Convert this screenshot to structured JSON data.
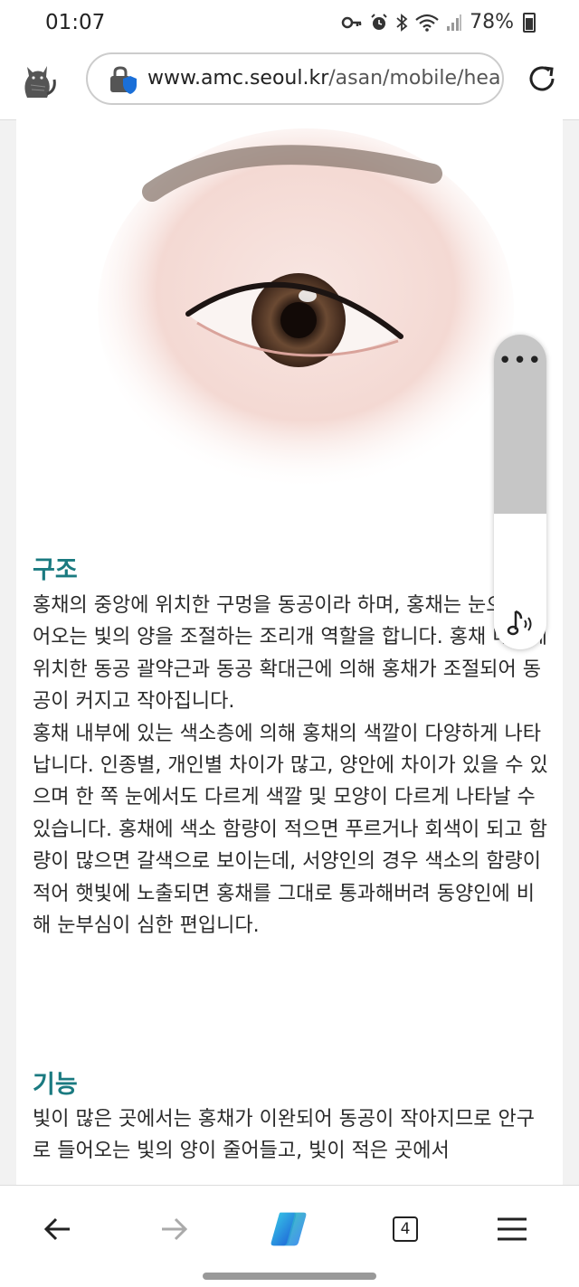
{
  "status_bar": {
    "time": "01:07",
    "battery": "78%"
  },
  "browser": {
    "url_host": "www.amc.seoul.kr",
    "url_path": "/asan/mobile/healt",
    "tab_count": "4"
  },
  "article": {
    "structure_title": "구조",
    "structure_p1": "홍채의 중앙에 위치한 구멍을 동공이라 하며, 홍채는 눈으로 들어오는 빛의 양을 조절하는 조리개 역할을 합니다. 홍채 내부에 위치한 동공 괄약근과 동공 확대근에 의해 홍채가 조절되어 동공이 커지고 작아집니다.",
    "structure_p2": "홍채 내부에 있는 색소층에 의해 홍채의 색깔이 다양하게 나타납니다. 인종별, 개인별 차이가 많고, 양안에 차이가 있을 수 있으며 한 쪽 눈에서도 다르게 색깔 및 모양이 다르게 나타날 수 있습니다. 홍채에 색소 함량이 적으면 푸르거나 회색이 되고 함량이 많으면 갈색으로 보이는데, 서양인의 경우 색소의 함량이 적어 햇빛에 노출되면 홍채를 그대로 통과해버려 동양인에 비해 눈부심이 심한 편입니다.",
    "function_title": "기능",
    "function_p1": "빛이 많은 곳에서는 홍채가 이완되어 동공이 작아지므로 안구로 들어오는 빛의 양이 줄어들고, 빛이 적은 곳에서"
  },
  "colors": {
    "heading": "#1a7a80"
  },
  "icons": [
    "key-icon",
    "alarm-icon",
    "bluetooth-icon",
    "wifi-icon",
    "signal-icon",
    "battery-icon",
    "lock-shield-icon",
    "reload-icon",
    "more-icon",
    "music-note-icon",
    "back-arrow-icon",
    "forward-arrow-icon",
    "copilot-icon",
    "tabs-icon",
    "menu-icon"
  ]
}
